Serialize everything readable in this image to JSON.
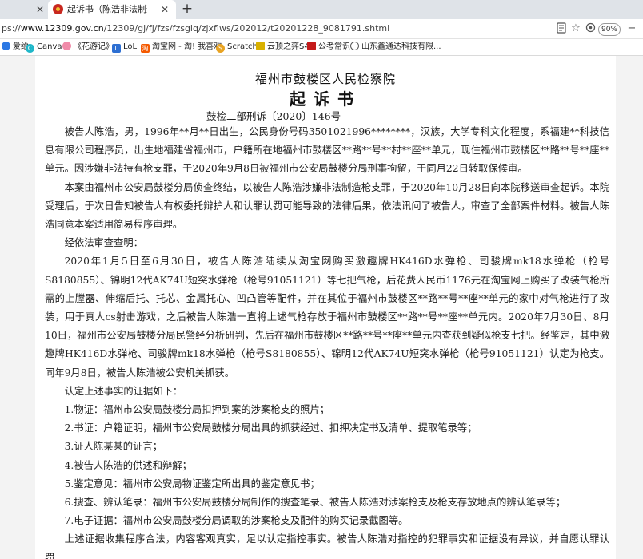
{
  "tabs": [
    {
      "title": "",
      "active": false
    },
    {
      "title": "起诉书（陈浩非法制造枪支案）",
      "active": true
    }
  ],
  "new_tab_label": "+",
  "address": {
    "scheme": "ps://",
    "host": "www.12309.gov.cn",
    "path": "/12309/gj/fj/fzs/fzsglq/zjxflws/202012/t20201228_9081791.shtml",
    "zoom": "90%"
  },
  "bookmarks": [
    {
      "label": "爱绐",
      "icon": "site-icon",
      "color": "#2b78e4"
    },
    {
      "label": "Canva",
      "icon": "canva-icon",
      "color": "#1fb7c9"
    },
    {
      "label": "《花游记》",
      "icon": "site-icon",
      "color": "#f08aa8"
    },
    {
      "label": "LoL",
      "icon": "lol-icon",
      "color": "#2d6fd2"
    },
    {
      "label": "淘宝网 - 淘! 我喜欢",
      "icon": "taobao-icon",
      "color": "#f55a00"
    },
    {
      "label": "Scratch",
      "icon": "scratch-icon",
      "color": "#e8a322"
    },
    {
      "label": "云顶之弈S4",
      "icon": "site-icon",
      "color": "#d9b100"
    },
    {
      "label": "公考常识",
      "icon": "site-icon",
      "color": "#c41a1a"
    },
    {
      "label": "山东鑫通达科技有限...",
      "icon": "globe-icon",
      "color": "#555555"
    }
  ],
  "document": {
    "org": "福州市鼓楼区人民检察院",
    "title": "起诉书",
    "case_no": "鼓检二部刑诉〔2020〕146号",
    "paragraphs": [
      "被告人陈浩，男，1996年**月**日出生，公民身份号码3501021996********，汉族，大学专科文化程度，系福建**科技信息有限公司程序员，出生地福建省福州市，户籍所在地福州市鼓楼区**路**号**村**座**单元，现住福州市鼓楼区**路**号**座**单元。因涉嫌非法持有枪支罪，于2020年9月8日被福州市公安局鼓楼分局刑事拘留，于同月22日转取保候审。",
      "本案由福州市公安局鼓楼分局侦查终结，以被告人陈浩涉嫌非法制造枪支罪，于2020年10月28日向本院移送审查起诉。本院受理后，于次日告知被告人有权委托辩护人和认罪认罚可能导致的法律后果，依法讯问了被告人，审查了全部案件材料。被告人陈浩同意本案适用简易程序审理。",
      "经依法审查查明：",
      "2020年1月5日至6月30日，被告人陈浩陆续从淘宝网购买激趣牌HK416D水弹枪、司骏牌mk18水弹枪（枪号S8180855）、锦明12代AK74U短突水弹枪（枪号91051121）等七把气枪，后花费人民币1176元在淘宝网上购买了改装气枪所需的上膛器、伸缩后托、托芯、金属托心、凹凸管等配件，并在其位于福州市鼓楼区**路**号**座**单元的家中对气枪进行了改装，用于真人cs射击游戏，之后被告人陈浩一直将上述气枪存放于福州市鼓楼区**路**号**座**单元内。2020年7月30日、8月10日，福州市公安局鼓楼分局民警经分析研判，先后在福州市鼓楼区**路**号**座**单元内查获到疑似枪支七把。经鉴定，其中激趣牌HK416D水弹枪、司骏牌mk18水弹枪（枪号S8180855）、锦明12代AK74U短突水弹枪（枪号91051121）认定为枪支。同年9月8日，被告人陈浩被公安机关抓获。",
      "认定上述事实的证据如下：",
      "1.物证：福州市公安局鼓楼分局扣押到案的涉案枪支的照片；",
      "2.书证：户籍证明，福州市公安局鼓楼分局出具的抓获经过、扣押决定书及清单、提取笔录等；",
      "3.证人陈某某的证言；",
      "4.被告人陈浩的供述和辩解；",
      "5.鉴定意见：福州市公安局物证鉴定所出具的鉴定意见书；",
      "6.搜查、辨认笔录：福州市公安局鼓楼分局制作的搜查笔录、被告人陈浩对涉案枪支及枪支存放地点的辨认笔录等；",
      "7.电子证据：福州市公安局鼓楼分局调取的涉案枪支及配件的购买记录截图等。",
      "上述证据收集程序合法，内容客观真实，足以认定指控事实。被告人陈浩对指控的犯罪事实和证据没有异议，并自愿认罪认罚。"
    ]
  }
}
